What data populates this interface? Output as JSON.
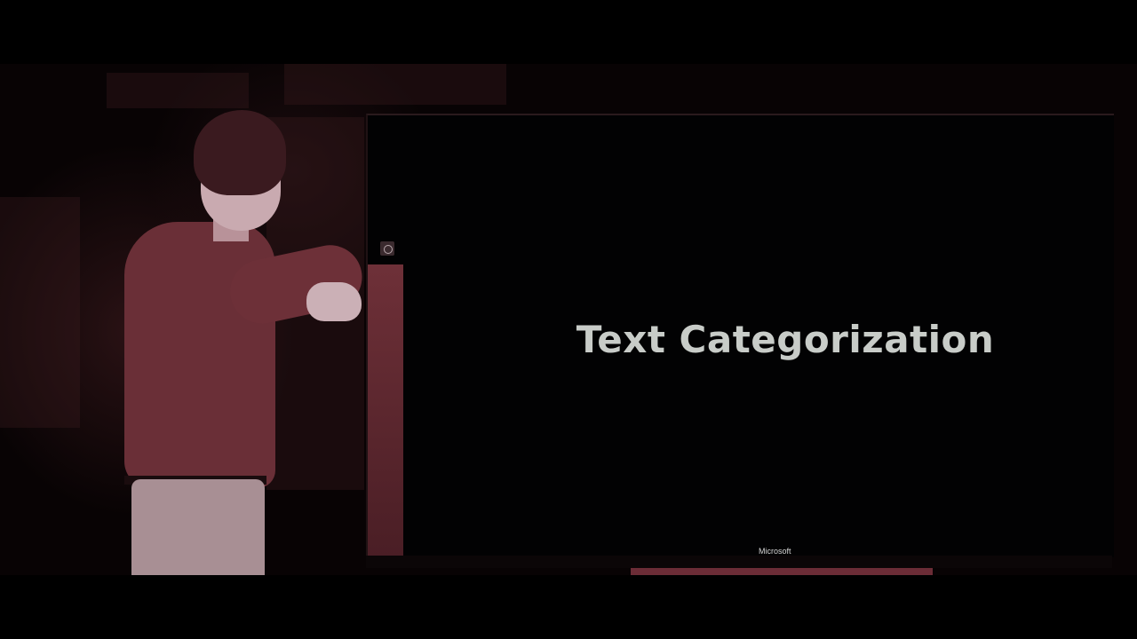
{
  "slide": {
    "title": "Text Categorization",
    "brand": "Microsoft"
  }
}
